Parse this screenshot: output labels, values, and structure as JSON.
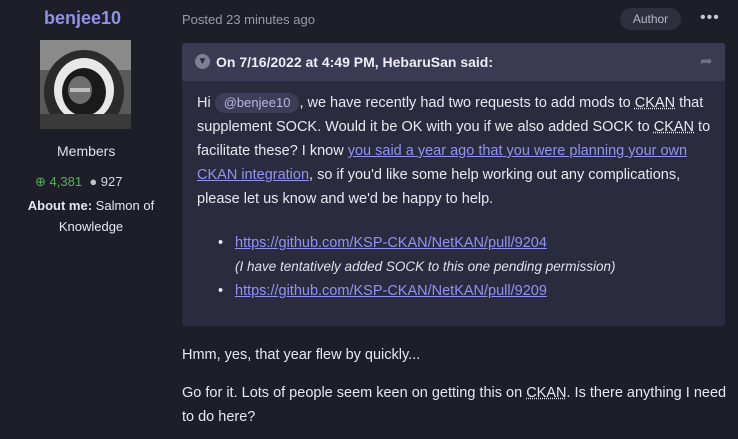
{
  "author": {
    "name": "benjee10",
    "group": "Members",
    "reputation": "4,381",
    "posts": "927",
    "about_label": "About me:",
    "about_value": "Salmon of Knowledge"
  },
  "post": {
    "posted": "Posted 23 minutes ago",
    "badge": "Author",
    "more": "•••"
  },
  "quote": {
    "cite": "On 7/16/2022 at 4:49 PM, HebaruSan said:",
    "hi": "Hi",
    "mention": "@benjee10",
    "t1": ", we have recently had two requests to add mods to ",
    "ckan": "CKAN",
    "t2": " that supplement SOCK. Would it be OK with you if we also added SOCK to ",
    "t3": " to facilitate these? I know ",
    "link_text": "you said a year ago that you were planning your own CKAN integration",
    "t4": ", so if you'd like some help working out any complications, please let us know and we'd be happy to help.",
    "items": [
      {
        "link": "https://github.com/KSP-CKAN/NetKAN/pull/9204",
        "note": "(I have tentatively added SOCK to this one pending permission)"
      },
      {
        "link": "https://github.com/KSP-CKAN/NetKAN/pull/9209",
        "note": ""
      }
    ]
  },
  "reply": {
    "p1": "Hmm, yes, that year flew by quickly...",
    "p2a": "Go for it. Lots of people seem keen on getting this on ",
    "ckan": "CKAN",
    "p2b": ". Is there anything I need to do here?"
  },
  "colors": {
    "background": "#1e1e29",
    "username": "#8f92e6",
    "link": "#9193f0",
    "reputation_green": "#55b25a"
  }
}
